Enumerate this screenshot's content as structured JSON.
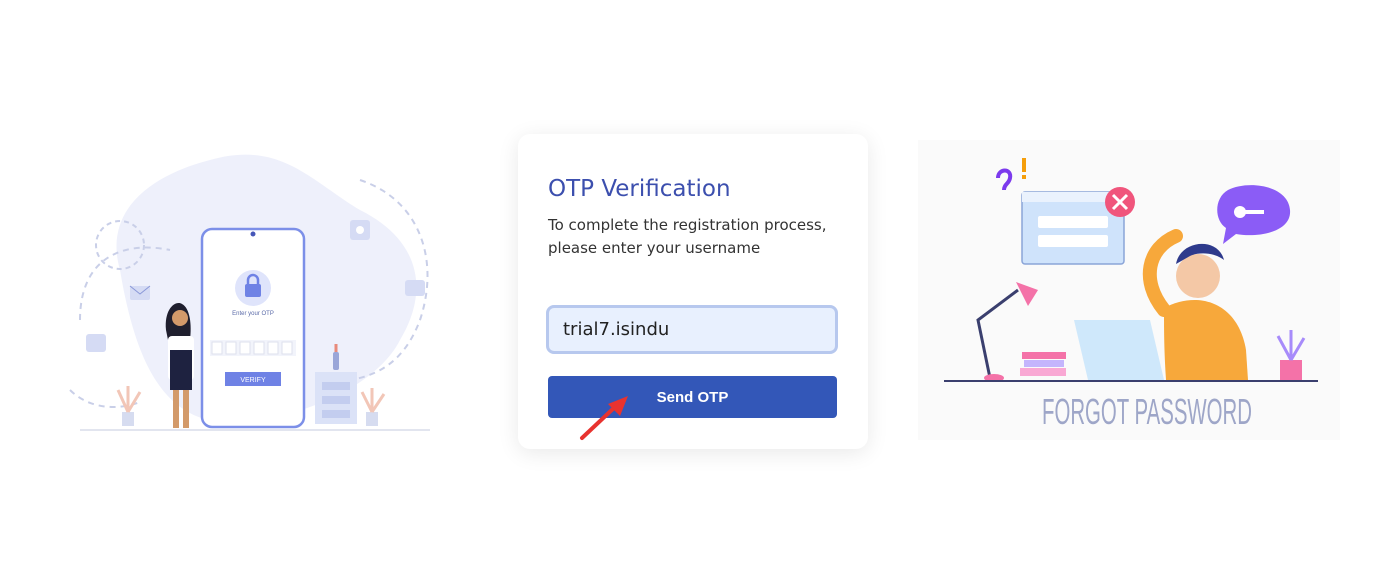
{
  "card": {
    "title": "OTP Verification",
    "subtitle": "To complete the registration process, please enter your username",
    "username_value": "trial7.isindu",
    "send_button_label": "Send OTP"
  },
  "left_illustration": {
    "screen_text": "Enter your OTP",
    "verify_label": "VERIFY"
  },
  "right_illustration": {
    "caption": "FORGOT PASSWORD"
  },
  "colors": {
    "title": "#3c4fae",
    "button": "#3357b8",
    "input_bg": "#e8f0fe",
    "input_border": "#b7c8ee",
    "arrow": "#e8332f"
  }
}
